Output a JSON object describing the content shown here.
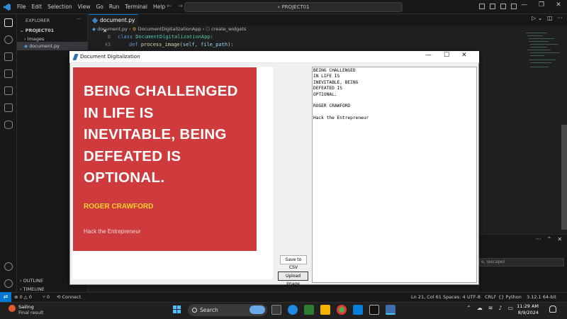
{
  "vscode": {
    "menu": [
      "File",
      "Edit",
      "Selection",
      "View",
      "Go",
      "Run",
      "Terminal",
      "Help"
    ],
    "search_text": "PROJECT01",
    "explorer_title": "EXPLORER",
    "project_name": "PROJECT01",
    "tree": [
      {
        "label": "Images",
        "icon": "chevron-right-icon"
      },
      {
        "label": "document.py",
        "icon": "python-file-icon"
      }
    ],
    "tab_label": "document.py",
    "breadcrumb": [
      "document.py",
      "DocumentDigitalizationApp",
      "create_widgets"
    ],
    "code": [
      {
        "ln": "8",
        "kw": "class ",
        "name": "DocumentDigitalizationApp",
        "rest": ":"
      },
      {
        "ln": "43",
        "kw": "def ",
        "name": "process_image",
        "rest": "(self, file_path):"
      }
    ],
    "outline_label": "OUTLINE",
    "timeline_label": "TIMELINE",
    "panel_escape_text": "e, \\escape)",
    "status": {
      "errors": "0",
      "warnings": "0",
      "ports": "0",
      "connect": "Connect",
      "position": "Ln 21, Col 61",
      "spaces": "Spaces: 4",
      "encoding": "UTF-8",
      "eol": "CRLF",
      "language": "Python",
      "interpreter": "3.12.1 64-bit"
    }
  },
  "taskbar": {
    "weather_title": "Sailing",
    "weather_sub": "Final result",
    "search_placeholder": "Search",
    "time": "11:29 AM",
    "date": "8/9/2024"
  },
  "app": {
    "title": "Document Digitalization",
    "image_quote_lines": "BEING CHALLENGED\nIN LIFE IS\nINEVITABLE, BEING\nDEFEATED IS\nOPTIONAL.",
    "image_author": "ROGER CRAWFORD",
    "image_brand": "Hack the Entrepreneur",
    "save_csv_label": "Save to CSV",
    "upload_label": "Upload Image",
    "ocr_text": "BEING CHALLENGED\nIN LIFE IS\nINEVITABLE, BEING\nDEFEATED IS\nOPTIONAL.\n\nROGER CRAWFORD\n\nHack the Entrepreneur"
  }
}
